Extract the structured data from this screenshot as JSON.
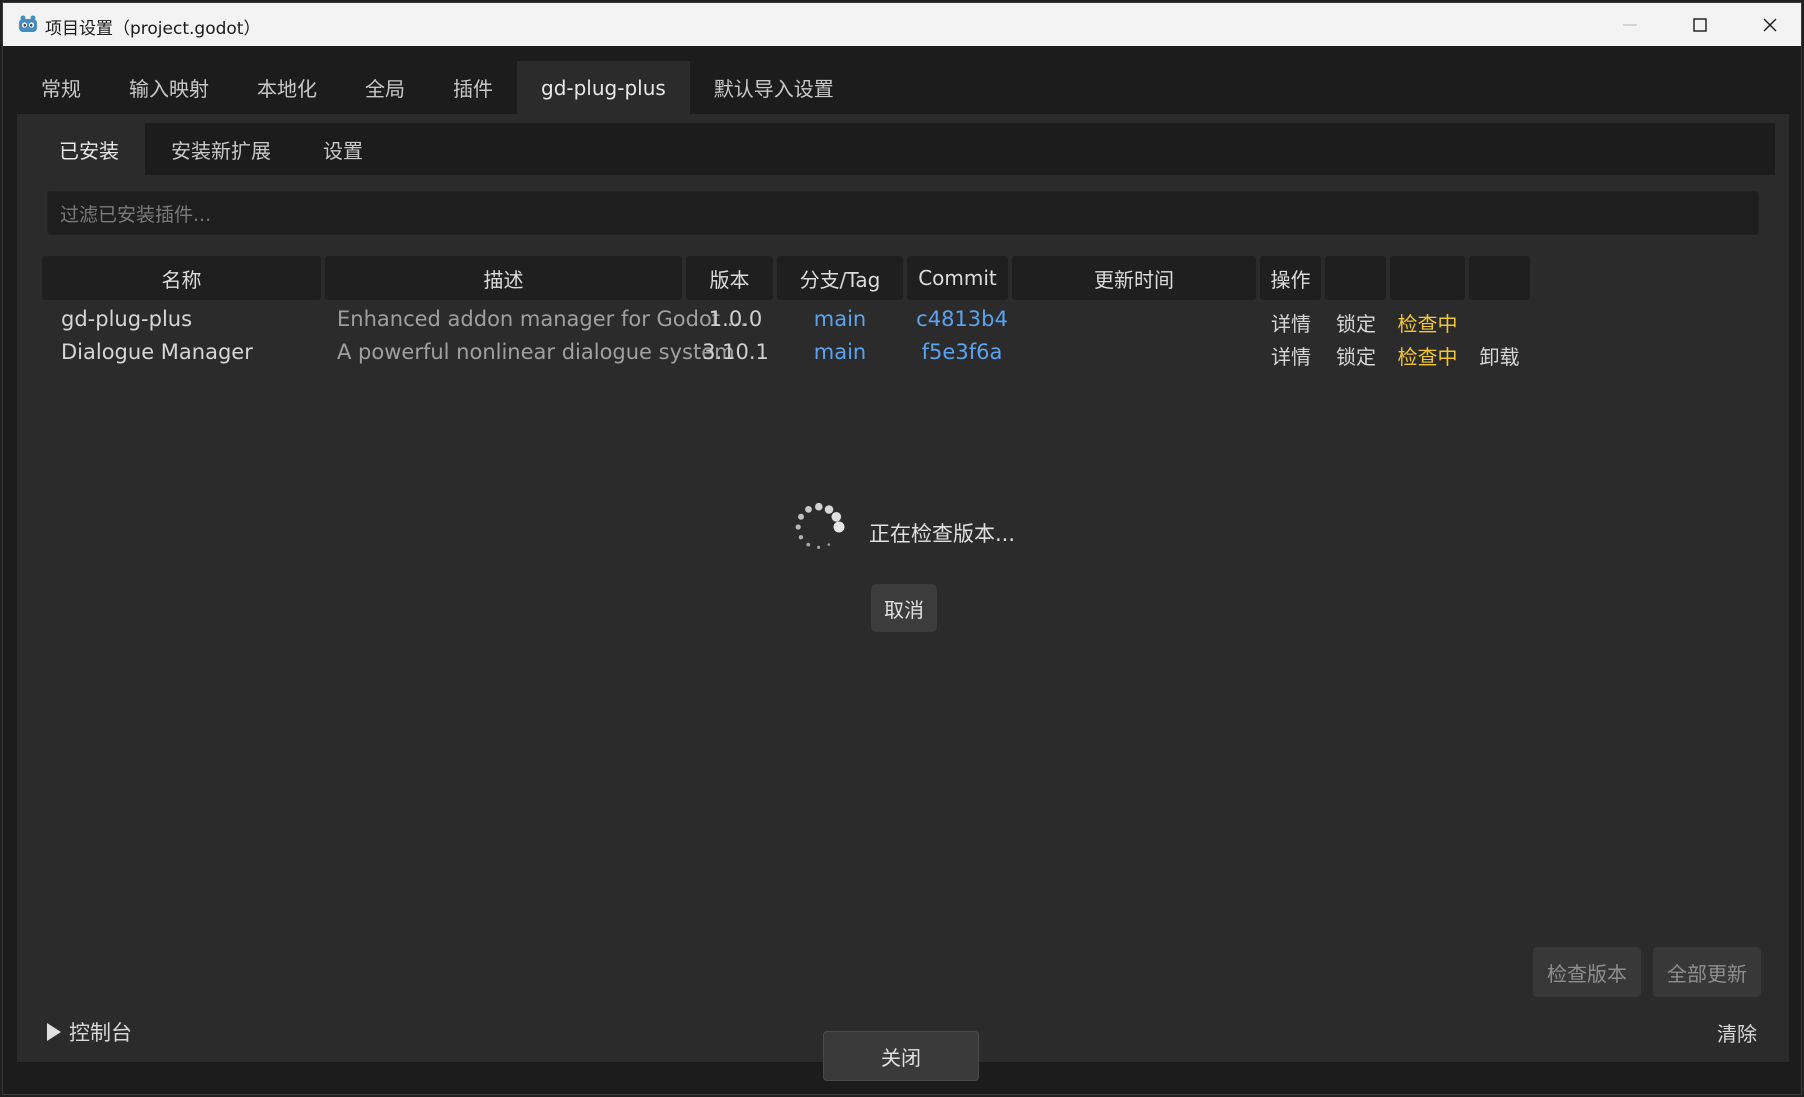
{
  "window": {
    "title": "项目设置（project.godot）"
  },
  "main_tabs": [
    "常规",
    "输入映射",
    "本地化",
    "全局",
    "插件",
    "gd-plug-plus",
    "默认导入设置"
  ],
  "sub_tabs": [
    "已安装",
    "安装新扩展",
    "设置"
  ],
  "filter": {
    "placeholder": "过滤已安装插件..."
  },
  "table": {
    "headers": [
      "名称",
      "描述",
      "版本",
      "分支/Tag",
      "Commit",
      "更新时间",
      "操作"
    ],
    "rows": [
      {
        "name": "gd-plug-plus",
        "description": "Enhanced addon manager for Godot ...",
        "version": "1.0.0",
        "branch": "main",
        "commit": "c4813b4",
        "updated": "",
        "action_details": "详情",
        "action_lock": "锁定",
        "status": "检查中"
      },
      {
        "name": "Dialogue Manager",
        "description": "A powerful nonlinear dialogue system",
        "version": "3.10.1",
        "branch": "main",
        "commit": "f5e3f6a",
        "updated": "",
        "action_details": "详情",
        "action_lock": "锁定",
        "status": "检查中",
        "action_uninstall": "卸载"
      }
    ]
  },
  "loading": {
    "text": "正在检查版本...",
    "cancel": "取消"
  },
  "footer_buttons": {
    "check_version": "检查版本",
    "update_all": "全部更新"
  },
  "console": {
    "label": "控制台",
    "clear": "清除"
  },
  "close_button": "关闭",
  "colors": {
    "link": "#5aa3f0",
    "warning": "#f2c735",
    "panel": "#2b2b2b"
  }
}
